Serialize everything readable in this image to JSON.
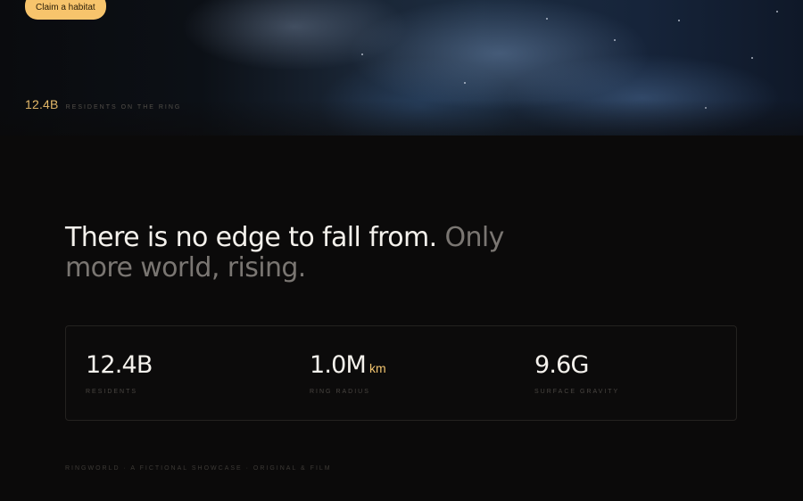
{
  "header": {
    "cta_label": "Claim a habitat",
    "hero_stat": {
      "value": "12.4B",
      "label": "Residents on the ring"
    }
  },
  "headline": {
    "strong": "There is no edge to fall from.",
    "muted": "Only more world, rising."
  },
  "stats": [
    {
      "value": "12.4B",
      "unit": "",
      "label": "Residents"
    },
    {
      "value": "1.0M",
      "unit": "km",
      "label": "Ring radius"
    },
    {
      "value": "9.6G",
      "unit": "",
      "label": "Surface gravity"
    }
  ],
  "footer": {
    "text": "Ringworld · A fictional showcase · Original & film"
  },
  "colors": {
    "accent": "#f2c46f",
    "cta_background": "#f7c46c",
    "background": "#0b0a0a"
  }
}
